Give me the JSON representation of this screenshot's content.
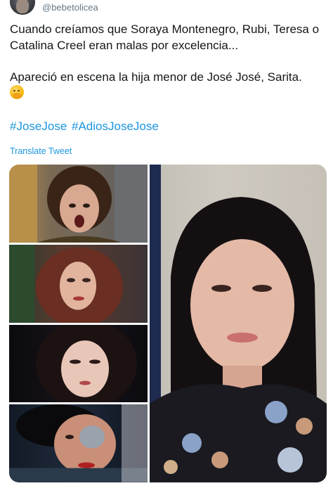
{
  "author": {
    "handle": "@bebetolicea"
  },
  "tweet": {
    "line1": "Cuando creíamos que Soraya Montenegro, Rubi, Teresa o Catalina Creel eran  malas por excelencia...",
    "line2": "Apareció en escena la hija menor de José José, Sarita.",
    "emoji": "face-with-hand-over-mouth",
    "hashtags": [
      "#JoseJose",
      "#AdiosJoseJose"
    ],
    "translate_label": "Translate Tweet"
  },
  "media": {
    "photo_count": 5
  },
  "colors": {
    "link": "#1b95e0",
    "text": "#14171a",
    "muted": "#657786"
  }
}
